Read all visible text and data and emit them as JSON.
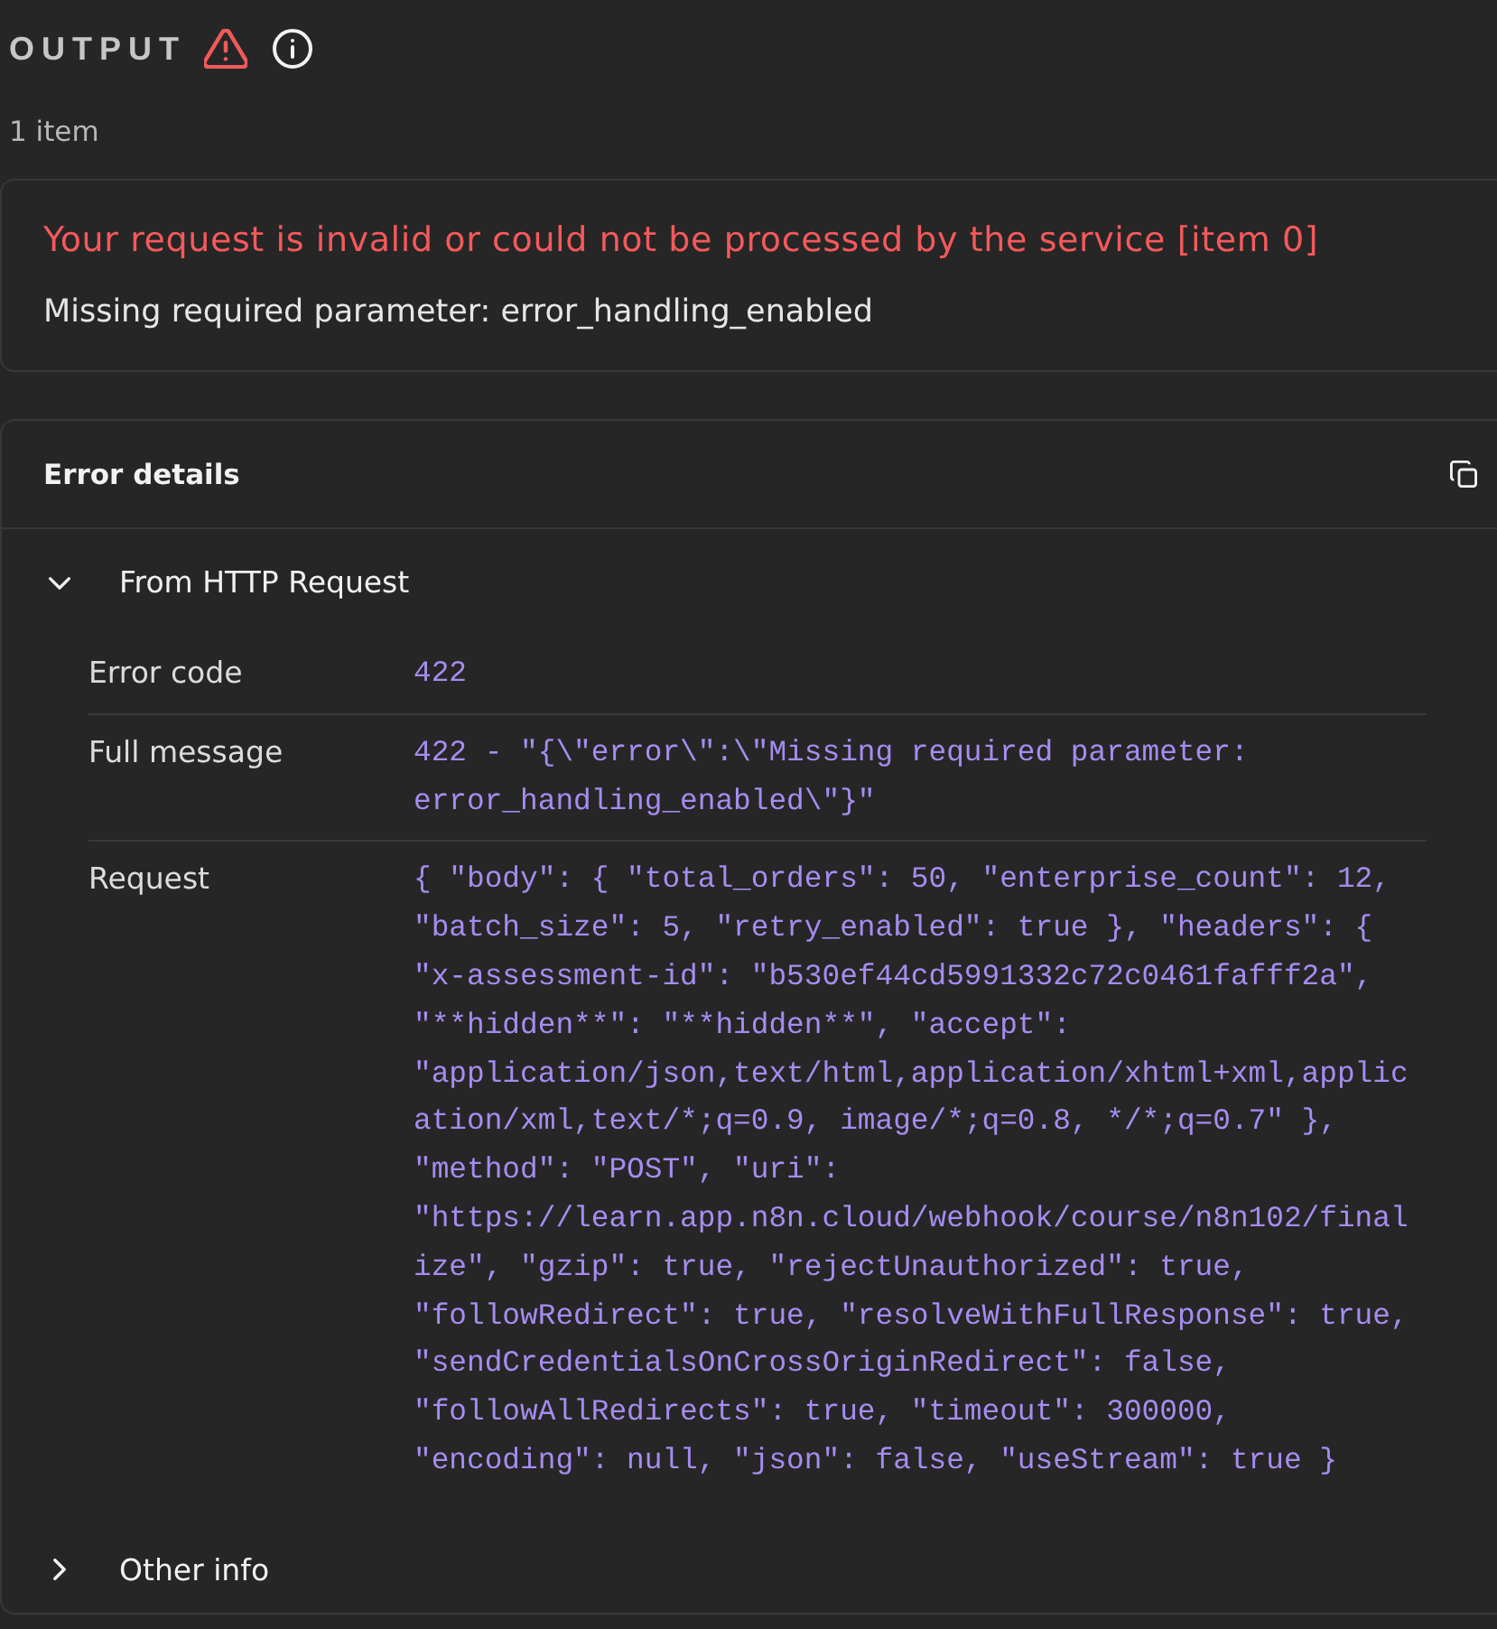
{
  "header": {
    "title": "OUTPUT"
  },
  "item_count": "1 item",
  "error": {
    "title": "Your request is invalid or could not be processed by the service [item 0]",
    "message": "Missing required parameter: error_handling_enabled"
  },
  "details": {
    "title": "Error details",
    "sections": [
      {
        "title": "From HTTP Request",
        "expanded": true,
        "rows": [
          {
            "label": "Error code",
            "value": "422"
          },
          {
            "label": "Full message",
            "value": "422 - \"{\\\"error\\\":\\\"Missing required parameter: error_handling_enabled\\\"}\""
          },
          {
            "label": "Request",
            "value": "{ \"body\": { \"total_orders\": 50, \"enterprise_count\": 12, \"batch_size\": 5, \"retry_enabled\": true }, \"headers\": { \"x-assessment-id\": \"b530ef44cd5991332c72c0461fafff2a\", \"**hidden**\": \"**hidden**\", \"accept\": \"application/json,text/html,application/xhtml+xml,application/xml,text/*;q=0.9, image/*;q=0.8, */*;q=0.7\" }, \"method\": \"POST\", \"uri\": \"https://learn.app.n8n.cloud/webhook/course/n8n102/finalize\", \"gzip\": true, \"rejectUnauthorized\": true, \"followRedirect\": true, \"resolveWithFullResponse\": true, \"sendCredentialsOnCrossOriginRedirect\": false, \"followAllRedirects\": true, \"timeout\": 300000, \"encoding\": null, \"json\": false, \"useStream\": true }"
          }
        ]
      },
      {
        "title": "Other info",
        "expanded": false
      }
    ]
  }
}
